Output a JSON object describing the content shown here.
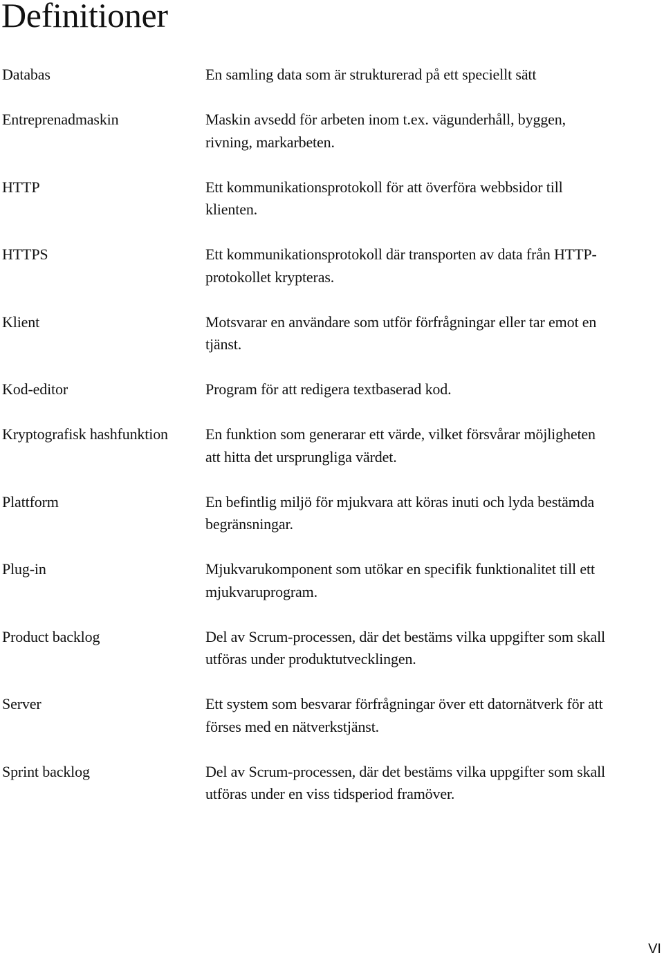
{
  "page": {
    "title": "Definitioner",
    "page_number": "VI"
  },
  "definitions": [
    {
      "term": "Databas",
      "lines": [
        "En samling data som är strukturerad på ett speciellt sätt"
      ]
    },
    {
      "term": "Entreprenadmaskin",
      "lines": [
        "Maskin avsedd för arbeten inom t.ex. vägunderhåll, byggen,",
        "rivning, markarbeten."
      ]
    },
    {
      "term": "HTTP",
      "lines": [
        "Ett kommunikationsprotokoll för att överföra webbsidor till",
        "klienten."
      ]
    },
    {
      "term": "HTTPS",
      "lines": [
        "Ett kommunikationsprotokoll där transporten av data från HTTP-",
        "protokollet krypteras."
      ]
    },
    {
      "term": "Klient",
      "lines": [
        "Motsvarar en användare som utför förfrågningar eller tar emot en",
        "tjänst."
      ]
    },
    {
      "term": "Kod-editor",
      "lines": [
        "Program för att redigera textbaserad kod."
      ]
    },
    {
      "term": "Kryptografisk hashfunktion",
      "lines": [
        "En funktion som generarar ett värde, vilket försvårar möjligheten",
        "att hitta det ursprungliga värdet."
      ]
    },
    {
      "term": "Plattform",
      "lines": [
        "En befintlig miljö för mjukvara att köras inuti och lyda bestämda",
        "begränsningar."
      ]
    },
    {
      "term": "Plug-in",
      "lines": [
        "Mjukvarukomponent som utökar en specifik funktionalitet till ett",
        "mjukvaruprogram."
      ]
    },
    {
      "term": "Product backlog",
      "lines": [
        "Del av Scrum-processen, där det bestäms vilka uppgifter som skall",
        "utföras under produktutvecklingen."
      ]
    },
    {
      "term": "Server",
      "lines": [
        "Ett system som besvarar förfrågningar över ett datornätverk för att",
        "förses med en nätverkstjänst."
      ]
    },
    {
      "term": "Sprint backlog",
      "lines": [
        "Del av Scrum-processen, där det bestäms vilka uppgifter som skall",
        "utföras under en viss tidsperiod framöver."
      ]
    }
  ]
}
